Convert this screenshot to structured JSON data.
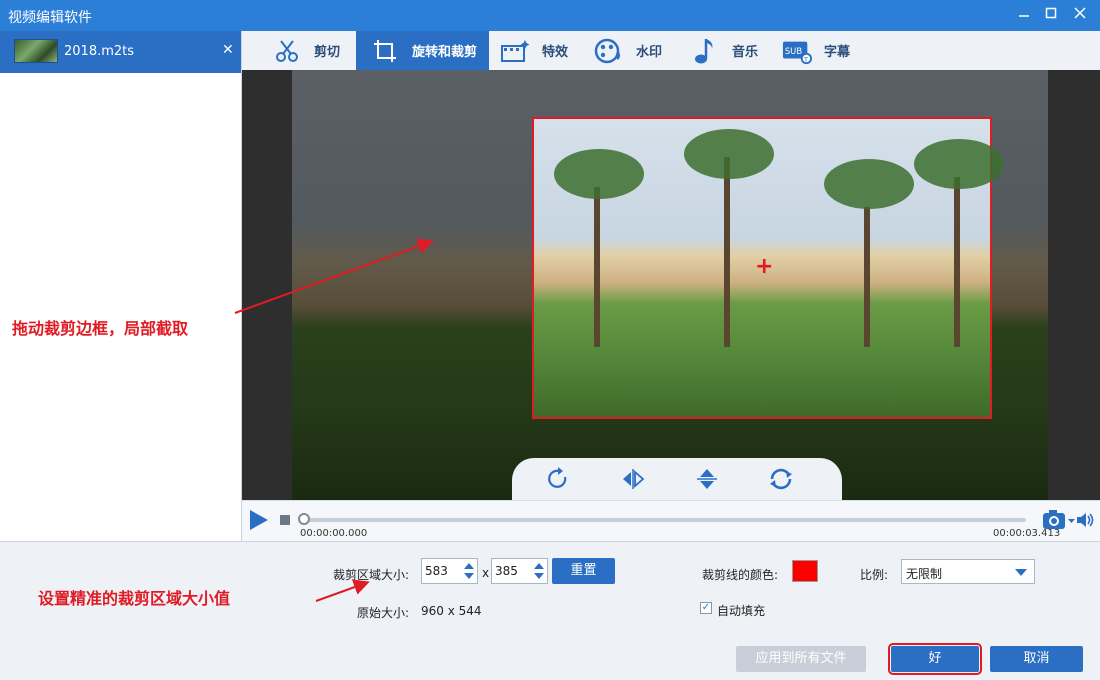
{
  "window": {
    "title": "视频编辑软件",
    "controls": [
      "minimize-icon",
      "maximize-icon",
      "close-icon"
    ]
  },
  "file_list": {
    "items": [
      {
        "name": "2018.m2ts"
      }
    ]
  },
  "tabs": [
    {
      "label": "剪切",
      "icon": "scissors-icon",
      "active": false
    },
    {
      "label": "旋转和裁剪",
      "icon": "crop-icon",
      "active": true
    },
    {
      "label": "特效",
      "icon": "effects-icon",
      "active": false
    },
    {
      "label": "水印",
      "icon": "watermark-icon",
      "active": false
    },
    {
      "label": "音乐",
      "icon": "music-note-icon",
      "active": false
    },
    {
      "label": "字幕",
      "icon": "subtitle-icon",
      "active": false
    }
  ],
  "player": {
    "current_time": "00:00:00.000",
    "total_time": "00:00:03.413"
  },
  "crop": {
    "area_label": "裁剪区域大小:",
    "width": "583",
    "separator": "x",
    "height": "385",
    "reset_label": "重置",
    "original_label": "原始大小:",
    "original_value": "960 x 544",
    "line_color_label": "裁剪线的颜色:",
    "line_color": "#ff0000",
    "ratio_label": "比例:",
    "ratio_value": "无限制",
    "autofill_label": "自动填充",
    "autofill_checked": true
  },
  "actions": {
    "apply_all": "应用到所有文件",
    "ok": "好",
    "cancel": "取消"
  },
  "annotations": {
    "drag_hint": "拖动裁剪边框，局部截取",
    "size_hint": "设置精准的裁剪区域大小值"
  },
  "colors": {
    "accent": "#2b6fc4",
    "titlebar": "#2c7fd6",
    "annotation": "#e01b24"
  }
}
